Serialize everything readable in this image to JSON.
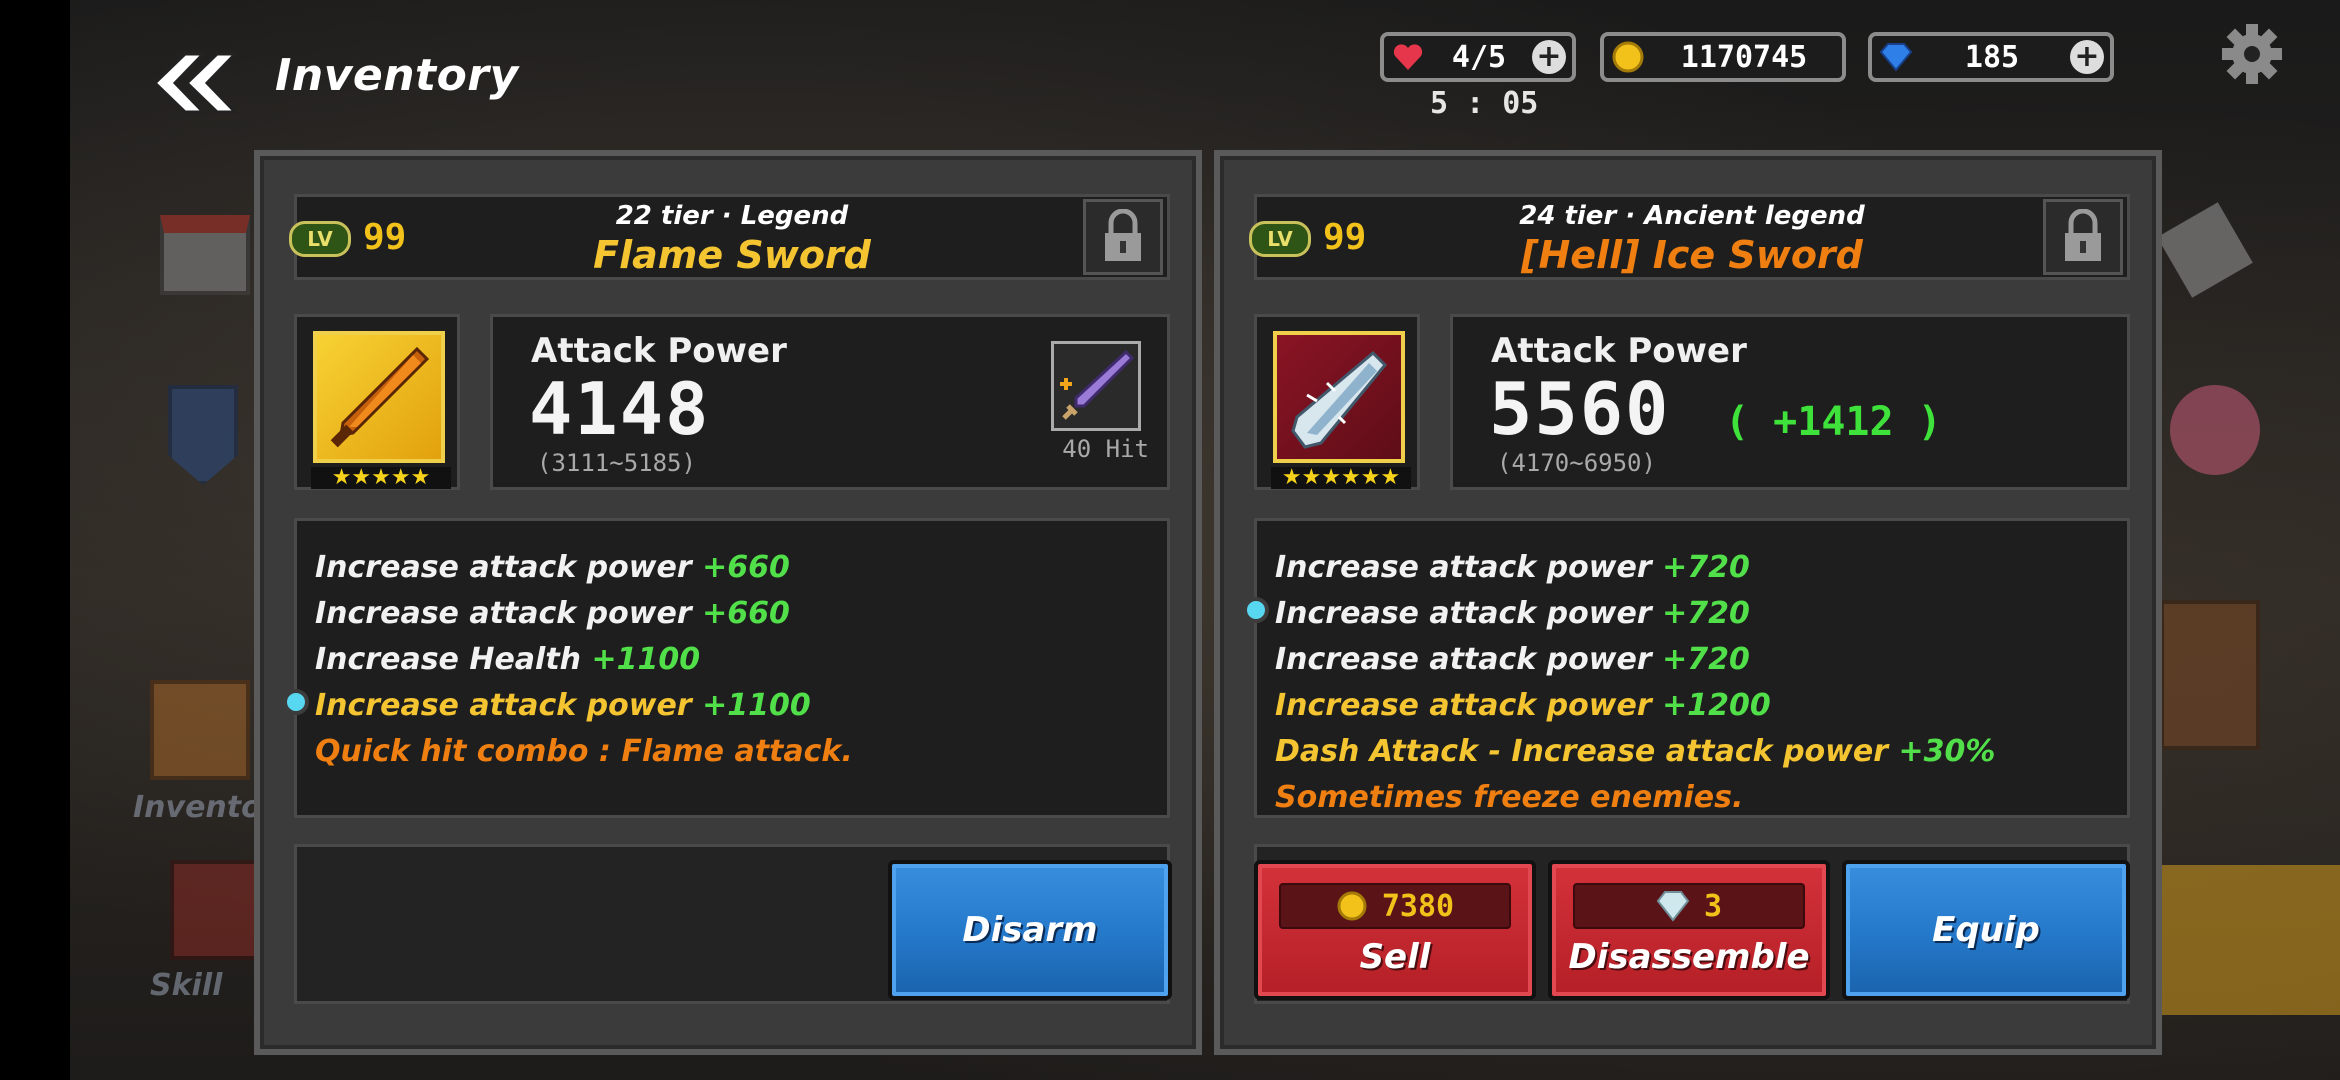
{
  "header": {
    "title": "Inventory"
  },
  "resources": {
    "hearts": "4/5",
    "gold": "1170745",
    "gems": "185",
    "timer": "5 : 05"
  },
  "background": {
    "inventory_label": "Invento",
    "skill_label": "Skill"
  },
  "left_item": {
    "level_badge": "LV",
    "level": "99",
    "tier": "22 tier  ·  Legend",
    "name": "Flame Sword",
    "name_color": "#f4c531",
    "stars": "★★★★★",
    "attack_label": "Attack Power",
    "attack_value": "4148",
    "attack_range": "(3111~5185)",
    "skill_hit": "40 Hit",
    "options": [
      {
        "text": "Increase attack power",
        "value": "+660"
      },
      {
        "text": "Increase attack power",
        "value": "+660"
      },
      {
        "text": "Increase Health",
        "value": "+1100"
      },
      {
        "text": "Increase attack power",
        "value": "+1100"
      },
      {
        "text": "Quick hit combo : Flame attack.",
        "value": ""
      }
    ],
    "disarm_label": "Disarm"
  },
  "right_item": {
    "level_badge": "LV",
    "level": "99",
    "tier": "24 tier  ·  Ancient legend",
    "name": "[Hell] Ice Sword",
    "name_color": "#f07f12",
    "stars": "★★★★★★",
    "attack_label": "Attack Power",
    "attack_value": "5560",
    "attack_diff": "( +1412 )",
    "attack_range": "(4170~6950)",
    "options": [
      {
        "text": "Increase attack power",
        "value": "+720"
      },
      {
        "text": "Increase attack power",
        "value": "+720"
      },
      {
        "text": "Increase attack power",
        "value": "+720"
      },
      {
        "text": "Increase attack power",
        "value": "+1200"
      },
      {
        "text": "Dash Attack - Increase attack power",
        "value": "+30%"
      },
      {
        "text": "Sometimes freeze enemies.",
        "value": ""
      }
    ],
    "sell_price": "7380",
    "sell_label": "Sell",
    "disassemble_count": "3",
    "disassemble_label": "Disassemble",
    "equip_label": "Equip"
  }
}
